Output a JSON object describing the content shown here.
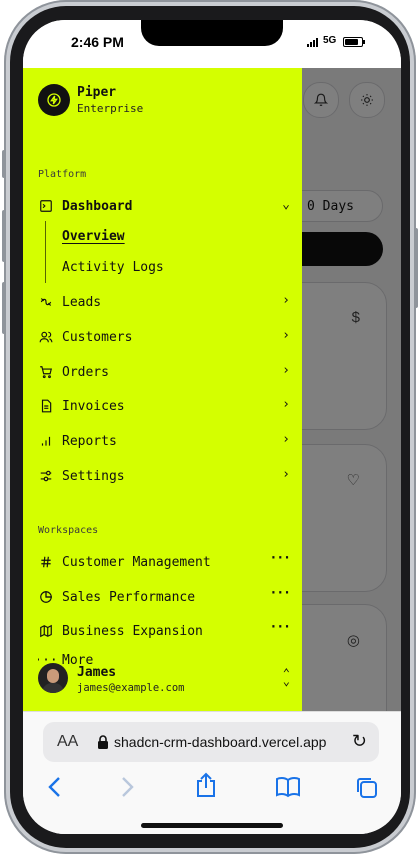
{
  "status_bar": {
    "time": "2:46 PM",
    "network": "5G"
  },
  "background": {
    "range_label": "0 Days",
    "card_icons": [
      "dollar-icon",
      "heart-icon",
      "target-icon"
    ]
  },
  "sidebar": {
    "brand": {
      "name": "Piper",
      "subtitle": "Enterprise"
    },
    "platform_label": "Platform",
    "platform_items": [
      {
        "label": "Dashboard",
        "icon": "dashboard-icon",
        "expanded": true
      },
      {
        "label": "Leads",
        "icon": "leads-icon"
      },
      {
        "label": "Customers",
        "icon": "users-icon"
      },
      {
        "label": "Orders",
        "icon": "cart-icon"
      },
      {
        "label": "Invoices",
        "icon": "file-icon"
      },
      {
        "label": "Reports",
        "icon": "bar-chart-icon"
      },
      {
        "label": "Settings",
        "icon": "settings-icon"
      }
    ],
    "dashboard_sub": [
      {
        "label": "Overview",
        "active": true
      },
      {
        "label": "Activity Logs"
      }
    ],
    "workspaces_label": "Workspaces",
    "workspaces": [
      {
        "label": "Customer Management",
        "icon": "hash-icon"
      },
      {
        "label": "Sales Performance",
        "icon": "pie-chart-icon"
      },
      {
        "label": "Business Expansion",
        "icon": "map-icon"
      },
      {
        "label": "More",
        "icon": "more-icon"
      }
    ],
    "user": {
      "name": "James",
      "email": "james@example.com"
    }
  },
  "browser": {
    "aa_label": "AA",
    "url": "shadcn-crm-dashboard.vercel.app"
  },
  "colors": {
    "sidebar_bg": "#d4ff00",
    "accent_blue": "#1a73e8"
  }
}
